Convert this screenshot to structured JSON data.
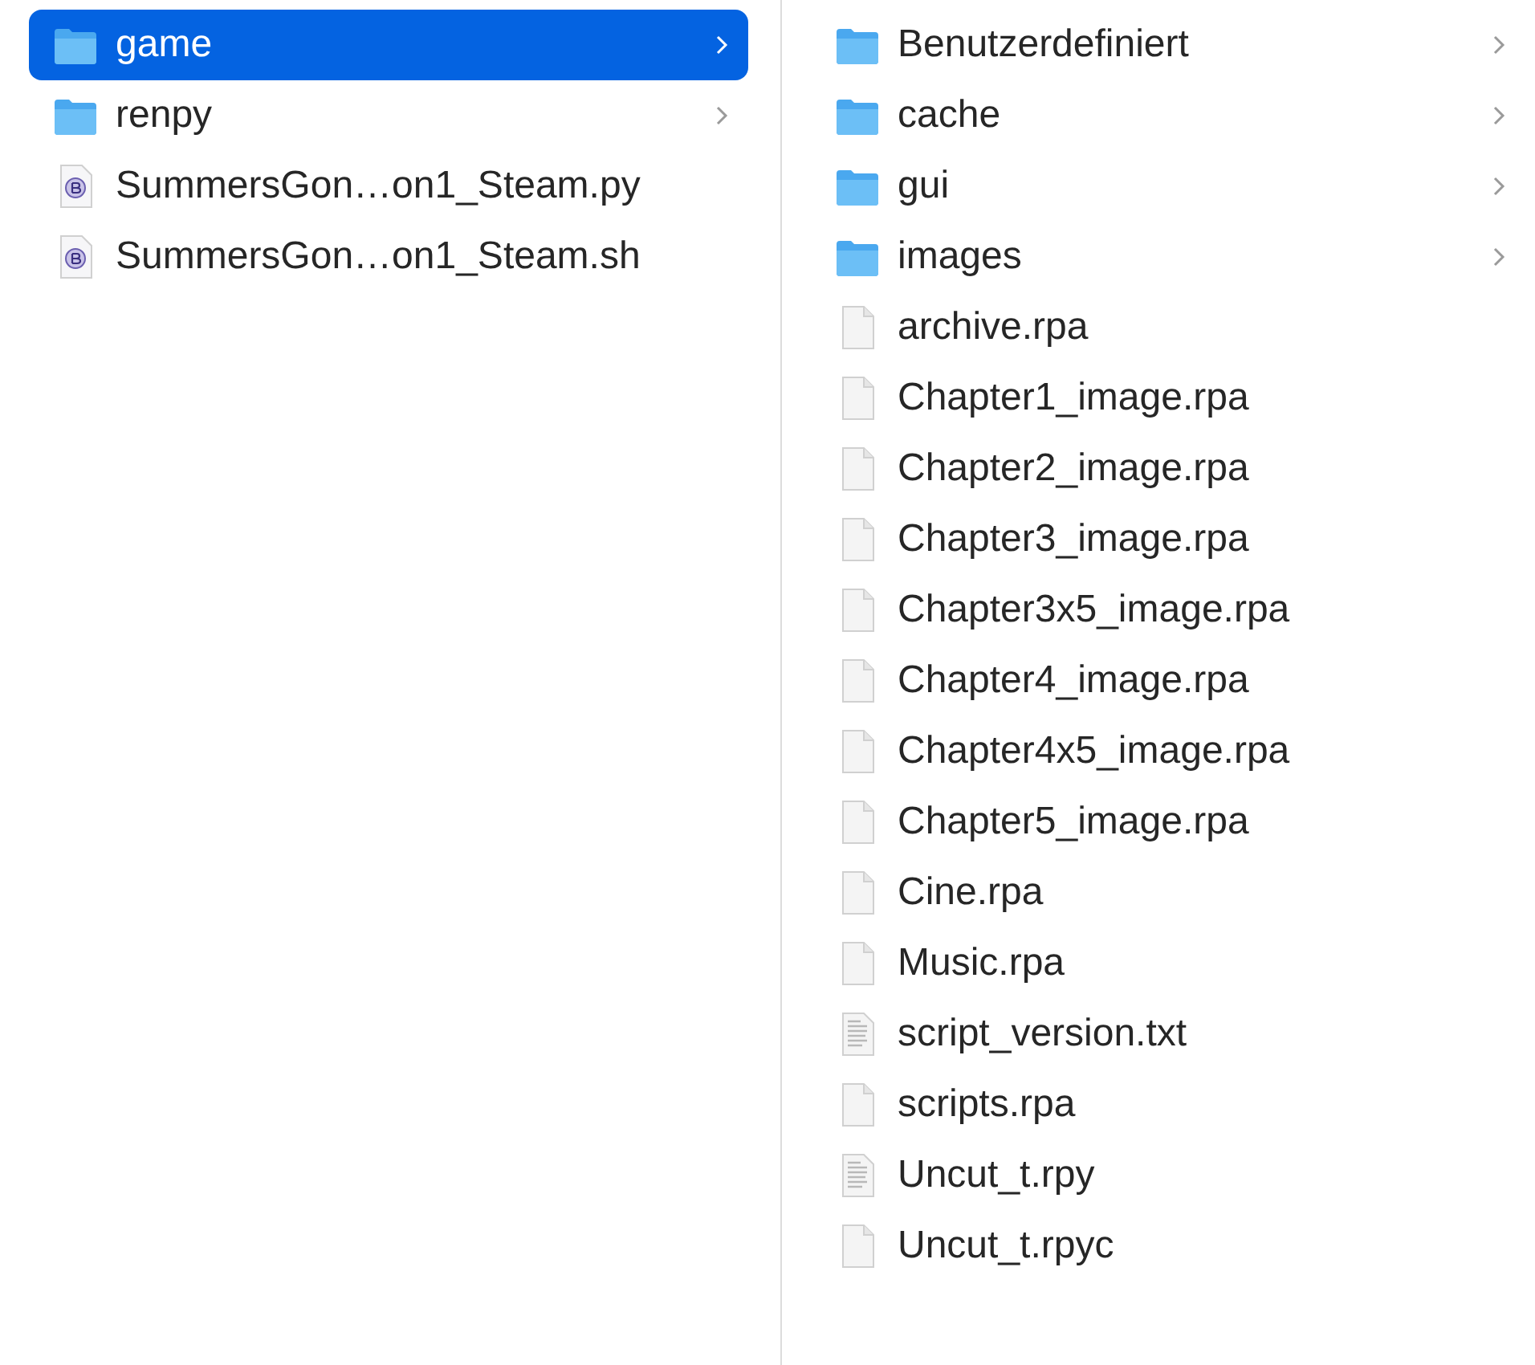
{
  "columns": [
    {
      "items": [
        {
          "name": "game",
          "kind": "folder",
          "selected": true
        },
        {
          "name": "renpy",
          "kind": "folder",
          "selected": false
        },
        {
          "name": "SummersGon…on1_Steam.py",
          "kind": "script",
          "selected": false
        },
        {
          "name": "SummersGon…on1_Steam.sh",
          "kind": "script",
          "selected": false
        }
      ]
    },
    {
      "items": [
        {
          "name": "Benutzerdefiniert",
          "kind": "folder",
          "selected": false
        },
        {
          "name": "cache",
          "kind": "folder",
          "selected": false
        },
        {
          "name": "gui",
          "kind": "folder",
          "selected": false
        },
        {
          "name": "images",
          "kind": "folder",
          "selected": false
        },
        {
          "name": "archive.rpa",
          "kind": "file",
          "selected": false
        },
        {
          "name": "Chapter1_image.rpa",
          "kind": "file",
          "selected": false
        },
        {
          "name": "Chapter2_image.rpa",
          "kind": "file",
          "selected": false
        },
        {
          "name": "Chapter3_image.rpa",
          "kind": "file",
          "selected": false
        },
        {
          "name": "Chapter3x5_image.rpa",
          "kind": "file",
          "selected": false
        },
        {
          "name": "Chapter4_image.rpa",
          "kind": "file",
          "selected": false
        },
        {
          "name": "Chapter4x5_image.rpa",
          "kind": "file",
          "selected": false
        },
        {
          "name": "Chapter5_image.rpa",
          "kind": "file",
          "selected": false
        },
        {
          "name": "Cine.rpa",
          "kind": "file",
          "selected": false
        },
        {
          "name": "Music.rpa",
          "kind": "file",
          "selected": false
        },
        {
          "name": "script_version.txt",
          "kind": "text",
          "selected": false
        },
        {
          "name": "scripts.rpa",
          "kind": "file",
          "selected": false
        },
        {
          "name": "Uncut_t.rpy",
          "kind": "text",
          "selected": false
        },
        {
          "name": "Uncut_t.rpyc",
          "kind": "file",
          "selected": false
        }
      ]
    }
  ]
}
